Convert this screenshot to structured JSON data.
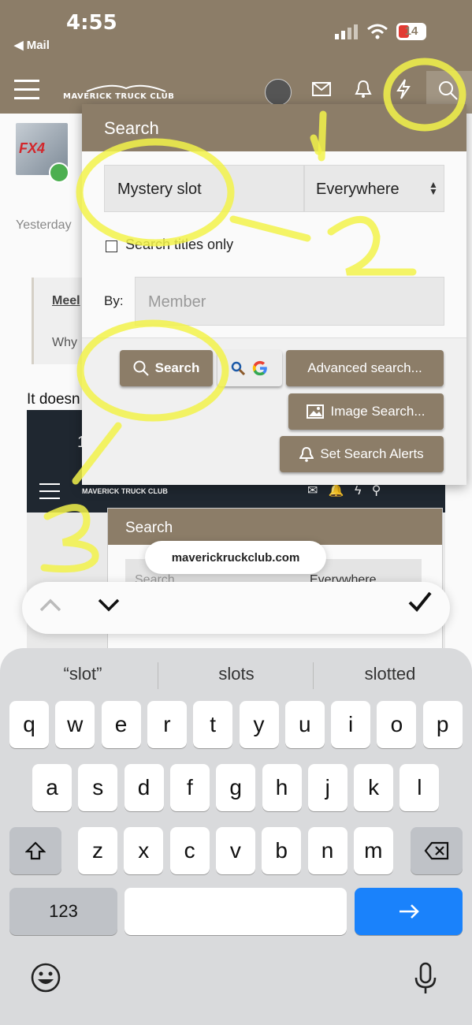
{
  "status": {
    "time": "4:55",
    "back_label": "◀ Mail",
    "battery": "14"
  },
  "header": {
    "logo_text": "MAVERICK TRUCK CLUB"
  },
  "page": {
    "avatar_badge": "FX4",
    "date": "Yesterday",
    "quote_author": "Meel",
    "quote_text": "Why",
    "post_text": "It doesn"
  },
  "embed": {
    "logo_text": "MAVERICK TRUCK CLUB",
    "panel_title": "Search",
    "search_placeholder": "Search",
    "scope": "Everywhere",
    "time_fragment": "1"
  },
  "popover": {
    "title": "Search",
    "search_value": "Mystery slot",
    "scope": "Everywhere",
    "titles_only_label": "Search titles only",
    "by_label": "By:",
    "member_placeholder": "Member",
    "search_button": "Search",
    "advanced_button": "Advanced search...",
    "image_button": "Image Search...",
    "alerts_button": "Set Search Alerts"
  },
  "url_pill": "maverickruckclub.com",
  "keyboard": {
    "suggestions": [
      "“slot”",
      "slots",
      "slotted"
    ],
    "row1": [
      "q",
      "w",
      "e",
      "r",
      "t",
      "y",
      "u",
      "i",
      "o",
      "p"
    ],
    "row2": [
      "a",
      "s",
      "d",
      "f",
      "g",
      "h",
      "j",
      "k",
      "l"
    ],
    "row3": [
      "z",
      "x",
      "c",
      "v",
      "b",
      "n",
      "m"
    ],
    "numbers_key": "123"
  },
  "annotations": [
    "1",
    "2",
    "3"
  ],
  "colors": {
    "brand": "#8c7d68",
    "go": "#1a82fb",
    "highlight": "#f2f24a"
  }
}
